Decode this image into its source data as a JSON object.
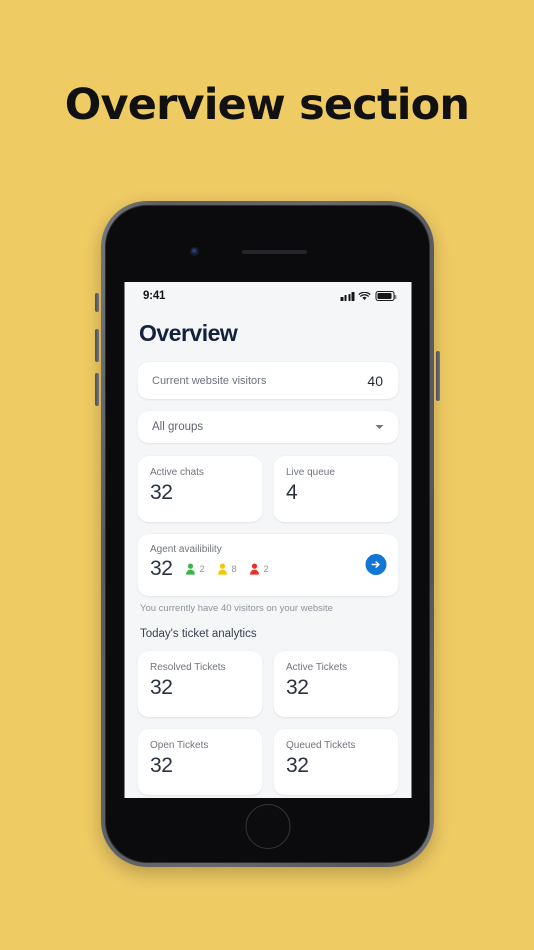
{
  "poster": {
    "title": "Overview section",
    "background_color": "#efcb64",
    "title_color": "#111114"
  },
  "device": {
    "type": "smartphone",
    "frame_color": "#5f6166"
  },
  "statusbar": {
    "time": "9:41",
    "cellular_icon": "signal-bars-icon",
    "wifi_icon": "wifi-icon",
    "battery_icon": "battery-full-icon"
  },
  "screen": {
    "app_title": "Overview",
    "visitors": {
      "label": "Current website visitors",
      "value": "40"
    },
    "groups_filter": {
      "selected": "All groups",
      "caret_icon": "chevron-down-icon"
    },
    "stats": [
      {
        "label": "Active chats",
        "value": "32"
      },
      {
        "label": "Live queue",
        "value": "4"
      }
    ],
    "agent_availability": {
      "label": "Agent availibility",
      "total": "32",
      "breakdown": [
        {
          "status": "online",
          "color": "#39b54a",
          "count": "2"
        },
        {
          "status": "away",
          "color": "#f7c600",
          "count": "8"
        },
        {
          "status": "offline",
          "color": "#e8302a",
          "count": "2"
        }
      ],
      "action_icon": "arrow-right-icon",
      "action_color": "#1276d6"
    },
    "helper_text": "You currently have 40 visitors on your website",
    "ticket_section": {
      "title": "Today's ticket analytics",
      "tickets": [
        {
          "label": "Resolved Tickets",
          "value": "32"
        },
        {
          "label": "Active Tickets",
          "value": "32"
        },
        {
          "label": "Open Tickets",
          "value": "32"
        },
        {
          "label": "Queued Tickets",
          "value": "32"
        }
      ]
    }
  }
}
